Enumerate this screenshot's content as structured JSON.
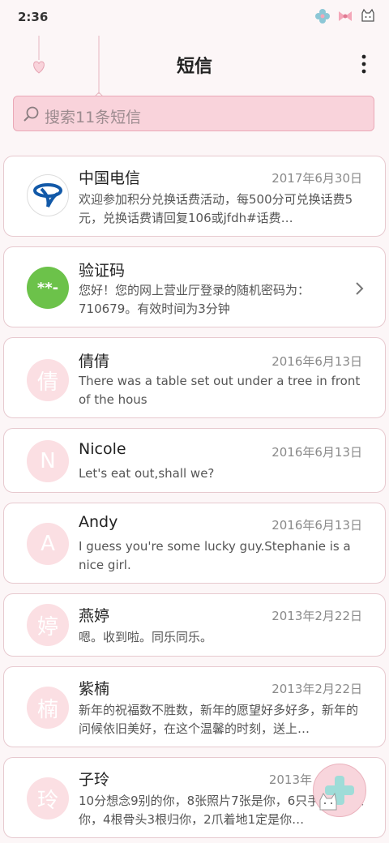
{
  "status_bar": {
    "time": "2:36"
  },
  "header": {
    "title": "短信"
  },
  "search": {
    "placeholder": "搜索11条短信"
  },
  "conversations": [
    {
      "name": "中国电信",
      "date": "2017年6月30日",
      "preview": "欢迎参加积分兑换话费活动，每500分可兑换话费5元，兑换话费请回复106或jfdh#话费…",
      "avatar_text": ""
    },
    {
      "name": "验证码",
      "date": "",
      "preview": "您好！您的网上营业厅登录的随机密码为：710679。有效时间为3分钟",
      "avatar_text": "**-"
    },
    {
      "name": "倩倩",
      "date": "2016年6月13日",
      "preview": "There was a table set out under a tree in front of the hous",
      "avatar_text": "倩"
    },
    {
      "name": "Nicole",
      "date": "2016年6月13日",
      "preview": "Let's eat out,shall we?",
      "avatar_text": "N"
    },
    {
      "name": "Andy",
      "date": "2016年6月13日",
      "preview": "I guess you're some lucky guy.Stephanie is a nice girl.",
      "avatar_text": "A"
    },
    {
      "name": "燕婷",
      "date": "2013年2月22日",
      "preview": "嗯。收到啦。同乐同乐。",
      "avatar_text": "婷"
    },
    {
      "name": "紫楠",
      "date": "2013年2月22日",
      "preview": "新年的祝福数不胜数，新年的愿望好多好多，新年的问候依旧美好，在这个温馨的时刻，送上…",
      "avatar_text": "楠"
    },
    {
      "name": "子玲",
      "date": "2013年",
      "preview": "10分想念9别的你，8张照片7张是你，6只手指5只像你，4根骨头3根归你，2爪着地1定是你…",
      "avatar_text": "玲"
    }
  ],
  "colors": {
    "accent_pink": "#f9d3db",
    "telecom_blue": "#1259a8",
    "verify_green": "#6cc24a"
  }
}
